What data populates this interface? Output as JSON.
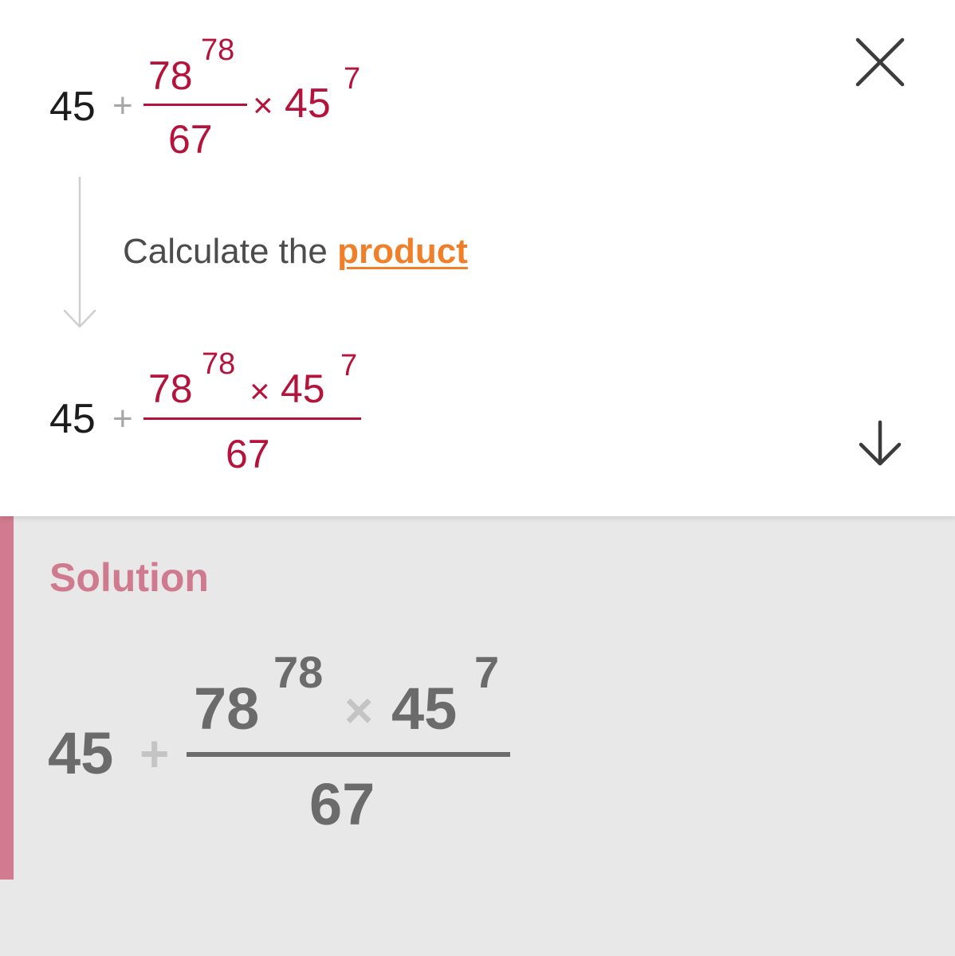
{
  "step": {
    "before": {
      "whole": "45",
      "plus": "+",
      "numerator_base": "78",
      "numerator_exp": "78",
      "denominator": "67",
      "times": "×",
      "factor_base": "45",
      "factor_exp": "7"
    },
    "instruction": {
      "prefix": "Calculate the ",
      "term": "product"
    },
    "after": {
      "whole": "45",
      "plus": "+",
      "numerator_base": "78",
      "numerator_exp": "78",
      "times": "×",
      "factor_base": "45",
      "factor_exp": "7",
      "denominator": "67"
    }
  },
  "solution": {
    "title": "Solution",
    "whole": "45",
    "plus": "+",
    "numerator_base": "78",
    "numerator_exp": "78",
    "times": "×",
    "factor_base": "45",
    "factor_exp": "7",
    "denominator": "67"
  },
  "colors": {
    "highlight_term": "#f07f2a",
    "expression_red": "#b5133c",
    "solution_accent": "#d27a8f"
  },
  "icons": {
    "close": "close-icon",
    "expand": "arrow-down-icon",
    "flow": "flow-arrow-icon"
  }
}
